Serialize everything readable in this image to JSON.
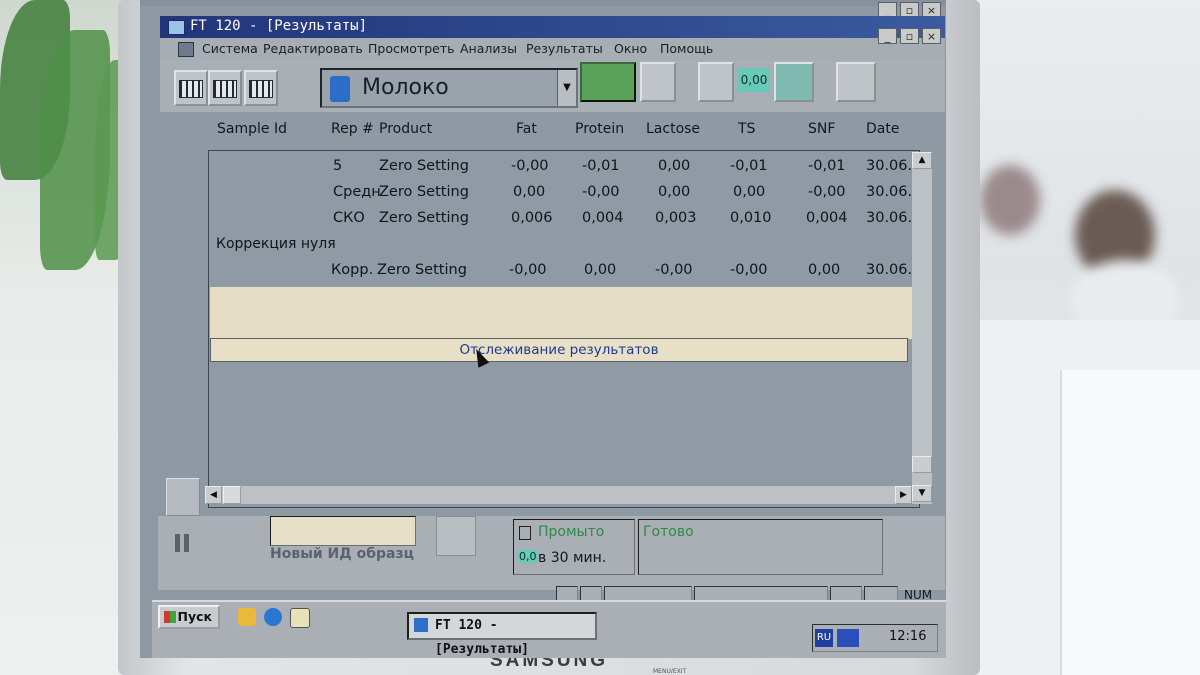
{
  "window": {
    "outer_title": "",
    "app_title": "FT 120 - [Результаты]",
    "title_buttons": [
      "_",
      "▫",
      "×"
    ]
  },
  "menu": {
    "items": [
      "Система",
      "Редактировать",
      "Просмотреть",
      "Анализы",
      "Результаты",
      "Окно",
      "Помощь"
    ]
  },
  "toolbar": {
    "product": "Молоко",
    "display_value": "0,00"
  },
  "table": {
    "headers": [
      "Sample Id",
      "Rep #",
      "Product",
      "Fat",
      "Protein",
      "Lactose",
      "TS",
      "SNF",
      "Date"
    ],
    "rows": [
      {
        "rep": "5",
        "product": "Zero Setting",
        "fat": "-0,00",
        "protein": "-0,01",
        "lactose": "0,00",
        "ts": "-0,01",
        "snf": "-0,01",
        "date": "30.06."
      },
      {
        "rep": "Средн",
        "product": "Zero Setting",
        "fat": "0,00",
        "protein": "-0,00",
        "lactose": "0,00",
        "ts": "0,00",
        "snf": "-0,00",
        "date": "30.06."
      },
      {
        "rep": "СКО",
        "product": "Zero Setting",
        "fat": "0,006",
        "protein": "0,004",
        "lactose": "0,003",
        "ts": "0,010",
        "snf": "0,004",
        "date": "30.06."
      },
      {
        "rep": "Корр.",
        "product": "Zero Setting",
        "fat": "-0,00",
        "protein": "0,00",
        "lactose": "-0,00",
        "ts": "-0,00",
        "snf": "0,00",
        "date": "30.06."
      }
    ],
    "group_label": "Коррекция нуля",
    "tracking_label": "Отслеживание результатов"
  },
  "status": {
    "new_id_label": "Новый ИД образц",
    "wash_status": "Промыто",
    "wash_value": "0,0",
    "wash_time": "в 30 мин.",
    "ready": "Готово",
    "num_indicator": "NUM"
  },
  "taskbar": {
    "start": "Пуск",
    "task": "FT 120 - [Результаты]",
    "lang": "RU",
    "clock": "12:16"
  },
  "monitor": {
    "brand": "SAMSUNG",
    "small_label": "MENU/EXIT"
  }
}
